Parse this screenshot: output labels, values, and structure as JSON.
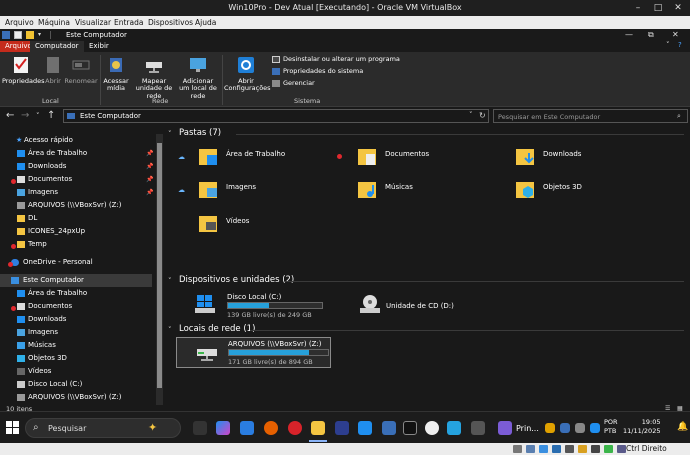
{
  "vbox": {
    "window_title": "Win10Pro - Dev Atual [Executando] - Oracle VM VirtualBox",
    "menu": [
      "Arquivo",
      "Máquina",
      "Visualizar",
      "Entrada",
      "Dispositivos",
      "Ajuda"
    ],
    "host_key_label": "Ctrl Direito"
  },
  "explorer": {
    "title": "Este Computador",
    "tabs": {
      "file": "Arquivo",
      "computer": "Computador",
      "view": "Exibir"
    },
    "ribbon": {
      "location": {
        "group": "Local",
        "properties": "Propriedades",
        "open": "Abrir",
        "rename": "Renomear"
      },
      "network": {
        "group": "Rede",
        "access_media": "Acessar mídia",
        "map_drive": "Mapear unidade de rede",
        "add_location": "Adicionar um local de rede"
      },
      "system": {
        "group": "Sistema",
        "open_settings": "Abrir Configurações",
        "uninstall": "Desinstalar ou alterar um programa",
        "system_props": "Propriedades do sistema",
        "manage": "Gerenciar"
      }
    },
    "address": {
      "path": "Este Computador",
      "search_placeholder": "Pesquisar em Este Computador"
    },
    "navpane": {
      "quick_access": "Acesso rápido",
      "quick_items": [
        "Área de Trabalho",
        "Downloads",
        "Documentos",
        "Imagens",
        "ARQUIVOS (\\\\VBoxSvr) (Z:)",
        "DL",
        "ICONES_24pxUp",
        "Temp"
      ],
      "onedrive": "OneDrive - Personal",
      "this_pc": "Este Computador",
      "pc_items": [
        "Área de Trabalho",
        "Documentos",
        "Downloads",
        "Imagens",
        "Músicas",
        "Objetos 3D",
        "Vídeos",
        "Disco Local (C:)",
        "ARQUIVOS (\\\\VBoxSvr) (Z:)"
      ]
    },
    "content": {
      "folders_header": "Pastas (7)",
      "folders": [
        "Área de Trabalho",
        "Documentos",
        "Downloads",
        "Imagens",
        "Músicas",
        "Objetos 3D",
        "Vídeos"
      ],
      "devices_header": "Dispositivos e unidades (2)",
      "local_disk": {
        "label": "Disco Local (C:)",
        "space": "139 GB livre(s) de 249 GB",
        "used_fraction": 0.44
      },
      "cd_drive": {
        "label": "Unidade de CD (D:)"
      },
      "network_header": "Locais de rede (1)",
      "network_drive": {
        "label": "ARQUIVOS (\\\\VBoxSvr) (Z:)",
        "space": "171 GB livre(s) de 894 GB",
        "used_fraction": 0.81
      }
    },
    "status": {
      "count": "10 itens"
    }
  },
  "taskbar": {
    "search_placeholder": "Pesquisar",
    "active_app_label": "Prin...",
    "lang_top": "POR",
    "lang_bottom": "PTB",
    "time": "19:05",
    "date": "11/11/2025"
  },
  "colors": {
    "accent_red": "#c42b1c",
    "folder_yellow": "#f4c542",
    "drive_bar": "#26a0da"
  }
}
